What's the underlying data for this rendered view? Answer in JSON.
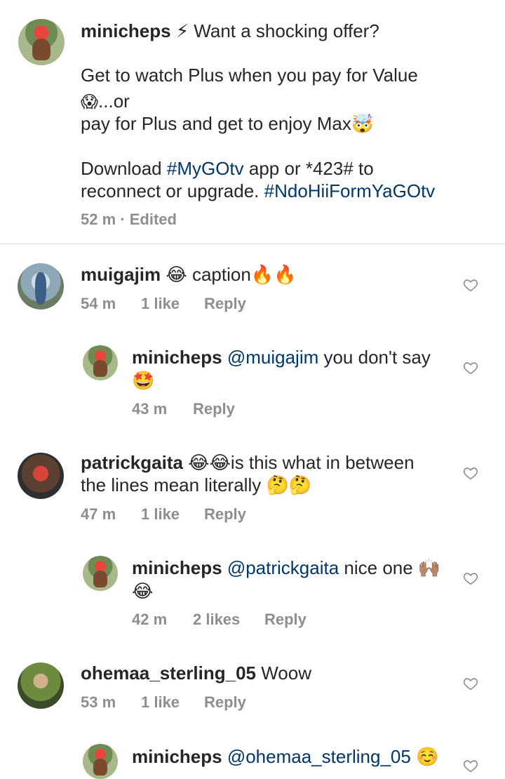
{
  "post": {
    "username": "minicheps",
    "line1": " ⚡ Want a shocking offer?",
    "line2": "Get to watch Plus when you pay for Value",
    "line3_emoji": "😱",
    "line3": "...or",
    "line4": " pay for Plus and get to enjoy Max🤯",
    "line5_a": "Download ",
    "line5_tag": "#MyGOtv",
    "line5_b": " app or *423# to",
    "line6_a": "reconnect or upgrade. ",
    "line6_tag": "#NdoHiiFormYaGOtv",
    "time": "52 m",
    "edited": "· Edited"
  },
  "comments": [
    {
      "username": "muigajim",
      "text": " 😂 caption🔥🔥",
      "time": "54 m",
      "likes": "1 like",
      "reply": "Reply"
    },
    {
      "username": "minicheps",
      "mention": "@muigajim",
      "text": " you don't say",
      "text2": "🤩",
      "time": "43 m",
      "reply": "Reply"
    },
    {
      "username": "patrickgaita",
      "text": " 😂😂is this what in between",
      "text2": "the lines mean literally 🤔🤔",
      "time": "47 m",
      "likes": "1 like",
      "reply": "Reply"
    },
    {
      "username": "minicheps",
      "mention": "@patrickgaita",
      "text": " nice one 🙌🏽",
      "text2": "😂",
      "time": "42 m",
      "likes": "2 likes",
      "reply": "Reply"
    },
    {
      "username": "ohemaa_sterling_05",
      "text": " Woow",
      "time": "53 m",
      "likes": "1 like",
      "reply": "Reply"
    },
    {
      "username": "minicheps",
      "mention": "@ohemaa_sterling_05",
      "text": " ☺️"
    }
  ],
  "icons": {
    "like": "heart-outline-icon"
  },
  "colors": {
    "text": "#262626",
    "secondary": "#8e8e8e",
    "link": "#00376b"
  }
}
